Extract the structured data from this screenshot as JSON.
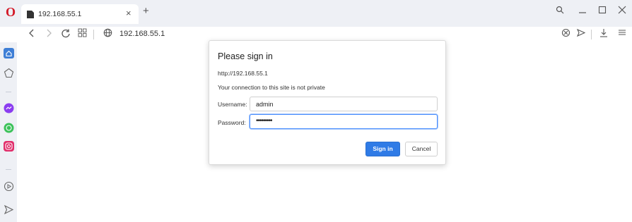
{
  "tab": {
    "title": "192.168.55.1",
    "close": "×",
    "new": "+"
  },
  "window_controls": {
    "search": "⚲",
    "minimize": "—",
    "maximize": "☐",
    "close": "×"
  },
  "address": {
    "url": "192.168.55.1"
  },
  "dialog": {
    "title": "Please sign in",
    "origin": "http://192.168.55.1",
    "warning": "Your connection to this site is not private",
    "username_label": "Username:",
    "username_value": "admin",
    "password_label": "Password:",
    "password_value": "•••••••••",
    "sign_in": "Sign in",
    "cancel": "Cancel"
  },
  "colors": {
    "accent": "#2f7be6",
    "opera_red": "#d31826",
    "chrome_bg": "#eef0f5"
  }
}
